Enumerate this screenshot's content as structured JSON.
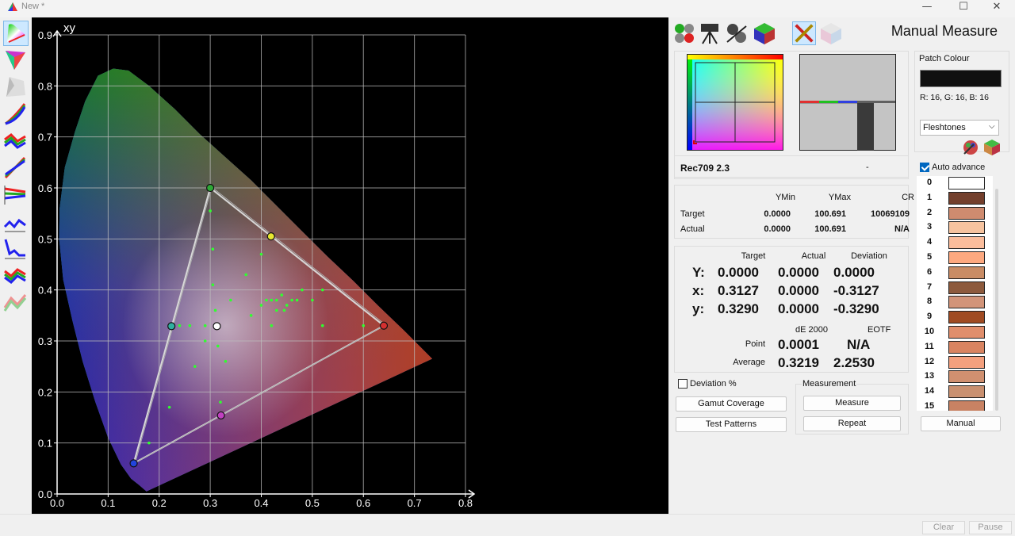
{
  "window": {
    "title": "New *",
    "minimize": "—",
    "maximize": "☐",
    "close": "✕"
  },
  "toolbar_left": [
    "cie-diagram-icon",
    "gamut-triangle-icon",
    "gamut-3d-icon",
    "rgb-levels-icon",
    "rgb-balance-icon",
    "gamma-curve-icon",
    "luminance-icon",
    "color-temperature-icon",
    "delta-e-icon",
    "contrast-icon",
    "saturation-icon"
  ],
  "toolbar_right": [
    "patterns-icon",
    "meter-icon",
    "calibrate-icon",
    "gamut-cube-icon",
    "manual-tool-icon",
    "cube-icon"
  ],
  "panel": {
    "title": "Manual Measure",
    "target_name": "Rec709 2.3",
    "target_dash": "-",
    "ytable": {
      "headers": [
        "YMin",
        "YMax",
        "CR"
      ],
      "rows": [
        {
          "label": "Target",
          "values": [
            "0.0000",
            "100.691",
            "10069109"
          ]
        },
        {
          "label": "Actual",
          "values": [
            "0.0000",
            "100.691",
            "N/A"
          ]
        }
      ]
    },
    "xy": {
      "headers": [
        "Target",
        "Actual",
        "Deviation"
      ],
      "rows": [
        {
          "label": "Y:",
          "values": [
            "0.0000",
            "0.0000",
            "0.0000"
          ]
        },
        {
          "label": "x:",
          "values": [
            "0.3127",
            "0.0000",
            "-0.3127"
          ]
        },
        {
          "label": "y:",
          "values": [
            "0.3290",
            "0.0000",
            "-0.3290"
          ]
        }
      ]
    },
    "de": {
      "headers": [
        "dE 2000",
        "EOTF"
      ],
      "rows": [
        {
          "label": "Point",
          "values": [
            "0.0001",
            "N/A"
          ]
        },
        {
          "label": "Average",
          "values": [
            "0.3219",
            "2.2530"
          ]
        }
      ]
    },
    "deviation_label": "Deviation %",
    "gamut_coverage": "Gamut Coverage",
    "test_patterns": "Test Patterns",
    "measurement_label": "Measurement",
    "measure": "Measure",
    "repeat": "Repeat"
  },
  "patch": {
    "label": "Patch Colour",
    "rgb_text": "R: 16, G: 16, B: 16",
    "swatch_color": "#101010",
    "dropdown": "Fleshtones",
    "auto_advance": "Auto advance",
    "manual": "Manual",
    "list": [
      {
        "n": "0",
        "c": "#ffffff"
      },
      {
        "n": "1",
        "c": "#733f2c"
      },
      {
        "n": "2",
        "c": "#cf8b6f"
      },
      {
        "n": "3",
        "c": "#f6c39f"
      },
      {
        "n": "4",
        "c": "#fbbd9c"
      },
      {
        "n": "5",
        "c": "#fda980"
      },
      {
        "n": "6",
        "c": "#c98c65"
      },
      {
        "n": "7",
        "c": "#8d5a3d"
      },
      {
        "n": "8",
        "c": "#d29479"
      },
      {
        "n": "9",
        "c": "#a04b22"
      },
      {
        "n": "10",
        "c": "#e08e6c"
      },
      {
        "n": "11",
        "c": "#d98461"
      },
      {
        "n": "12",
        "c": "#f4a07e"
      },
      {
        "n": "13",
        "c": "#d09070"
      },
      {
        "n": "14",
        "c": "#c99070"
      },
      {
        "n": "15",
        "c": "#c88263"
      }
    ]
  },
  "status": {
    "clear": "Clear",
    "pause": "Pause"
  },
  "chart_data": {
    "type": "scatter",
    "title": "xy",
    "xlim": [
      0,
      0.8
    ],
    "ylim": [
      0,
      0.9
    ],
    "xticks": [
      "0.0",
      "0.1",
      "0.2",
      "0.3",
      "0.4",
      "0.5",
      "0.6",
      "0.7",
      "0.8"
    ],
    "yticks": [
      "0.0",
      "0.1",
      "0.2",
      "0.3",
      "0.4",
      "0.5",
      "0.6",
      "0.7",
      "0.8",
      "0.9"
    ],
    "grid": true,
    "gamut_triangle": [
      [
        0.64,
        0.33
      ],
      [
        0.3,
        0.6
      ],
      [
        0.15,
        0.06
      ]
    ],
    "measured_triangle": [
      [
        0.64,
        0.33
      ],
      [
        0.3,
        0.6
      ],
      [
        0.15,
        0.06
      ]
    ],
    "primaries": [
      {
        "x": 0.3,
        "y": 0.6,
        "c": "#2ea836"
      },
      {
        "x": 0.15,
        "y": 0.06,
        "c": "#2244dd"
      },
      {
        "x": 0.64,
        "y": 0.33,
        "c": "#d43030"
      },
      {
        "x": 0.419,
        "y": 0.505,
        "c": "#e8e830"
      },
      {
        "x": 0.224,
        "y": 0.329,
        "c": "#30b0a0"
      },
      {
        "x": 0.321,
        "y": 0.154,
        "c": "#c040c0"
      },
      {
        "x": 0.313,
        "y": 0.329,
        "c": "#ffffff"
      }
    ],
    "points": [
      [
        0.3,
        0.555
      ],
      [
        0.305,
        0.48
      ],
      [
        0.305,
        0.41
      ],
      [
        0.37,
        0.43
      ],
      [
        0.4,
        0.47
      ],
      [
        0.34,
        0.38
      ],
      [
        0.38,
        0.35
      ],
      [
        0.4,
        0.37
      ],
      [
        0.41,
        0.38
      ],
      [
        0.42,
        0.38
      ],
      [
        0.43,
        0.38
      ],
      [
        0.44,
        0.39
      ],
      [
        0.45,
        0.37
      ],
      [
        0.46,
        0.38
      ],
      [
        0.47,
        0.38
      ],
      [
        0.48,
        0.4
      ],
      [
        0.5,
        0.38
      ],
      [
        0.52,
        0.4
      ],
      [
        0.42,
        0.33
      ],
      [
        0.52,
        0.33
      ],
      [
        0.6,
        0.33
      ],
      [
        0.31,
        0.36
      ],
      [
        0.315,
        0.29
      ],
      [
        0.33,
        0.26
      ],
      [
        0.29,
        0.3
      ],
      [
        0.27,
        0.25
      ],
      [
        0.32,
        0.18
      ],
      [
        0.22,
        0.17
      ],
      [
        0.18,
        0.1
      ],
      [
        0.24,
        0.33
      ],
      [
        0.26,
        0.33
      ],
      [
        0.29,
        0.33
      ],
      [
        0.445,
        0.36
      ],
      [
        0.43,
        0.36
      ]
    ]
  }
}
